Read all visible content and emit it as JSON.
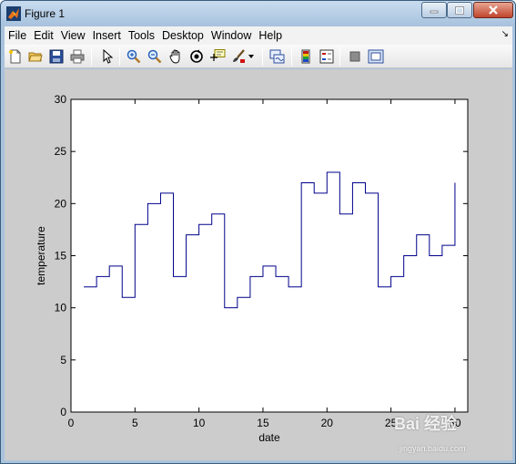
{
  "window": {
    "title": "Figure 1"
  },
  "menu": {
    "items": [
      "File",
      "Edit",
      "View",
      "Insert",
      "Tools",
      "Desktop",
      "Window",
      "Help"
    ]
  },
  "toolbar": {
    "buttons": [
      {
        "name": "new-figure-icon"
      },
      {
        "name": "open-file-icon"
      },
      {
        "name": "save-figure-icon"
      },
      {
        "name": "print-figure-icon"
      },
      {
        "name": "edit-plot-icon"
      },
      {
        "name": "zoom-in-icon"
      },
      {
        "name": "zoom-out-icon"
      },
      {
        "name": "pan-icon"
      },
      {
        "name": "rotate-3d-icon"
      },
      {
        "name": "data-cursor-icon"
      },
      {
        "name": "brush-icon"
      },
      {
        "name": "link-plot-icon"
      },
      {
        "name": "insert-colorbar-icon"
      },
      {
        "name": "insert-legend-icon"
      },
      {
        "name": "hide-plot-tools-icon"
      },
      {
        "name": "show-plot-tools-icon"
      }
    ]
  },
  "watermark": {
    "text": "Bai 经验",
    "subtext": "jingyan.baidu.com"
  },
  "chart_data": {
    "type": "line",
    "style": "stairs",
    "title": "",
    "xlabel": "date",
    "ylabel": "temperature",
    "xlim": [
      0,
      31
    ],
    "ylim": [
      0,
      30
    ],
    "x_ticks": [
      0,
      5,
      10,
      15,
      20,
      25,
      30
    ],
    "y_ticks": [
      0,
      5,
      10,
      15,
      20,
      25,
      30
    ],
    "grid": false,
    "series": [
      {
        "color": "#00008b",
        "x": [
          1,
          2,
          3,
          4,
          5,
          6,
          7,
          8,
          9,
          10,
          11,
          12,
          13,
          14,
          15,
          16,
          17,
          18,
          19,
          20,
          21,
          22,
          23,
          24,
          25,
          26,
          27,
          28,
          29,
          30
        ],
        "values": [
          12,
          13,
          14,
          11,
          18,
          20,
          21,
          13,
          17,
          18,
          19,
          10,
          11,
          13,
          14,
          13,
          12,
          22,
          21,
          23,
          19,
          22,
          21,
          12,
          13,
          15,
          17,
          15,
          16,
          22
        ]
      }
    ]
  }
}
